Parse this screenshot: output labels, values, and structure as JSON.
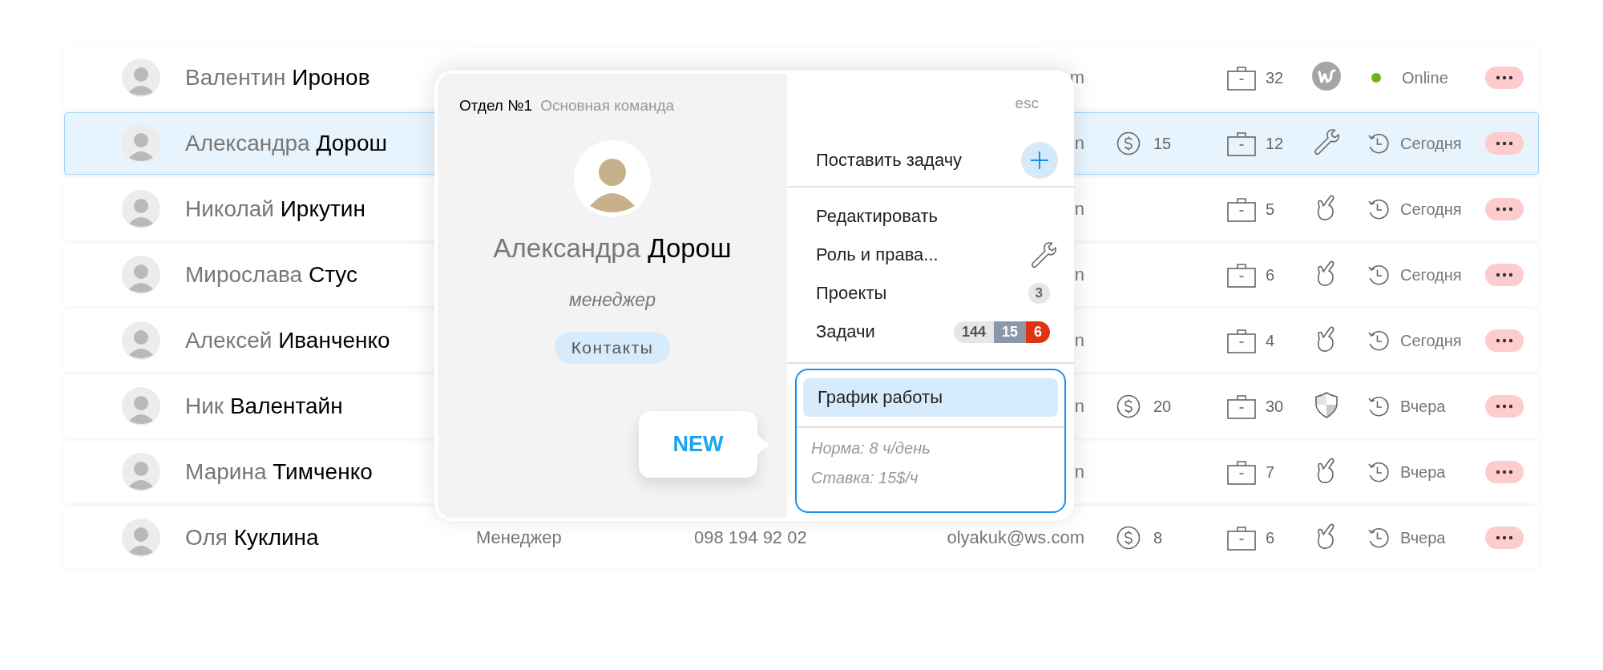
{
  "rows": [
    {
      "first": "Валентин",
      "last": "Иронов",
      "email": "m",
      "projects": "32",
      "access": {
        "kind": "logo"
      },
      "status": {
        "kind": "online",
        "text": "Online"
      },
      "selected": false
    },
    {
      "first": "Александра",
      "last": "Дорош",
      "email": "n",
      "payment": "15",
      "projects": "12",
      "access": {
        "kind": "wrench"
      },
      "status": {
        "kind": "recent",
        "text": "Сегодня"
      },
      "selected": true
    },
    {
      "first": "Николай",
      "last": "Иркутин",
      "email": "n",
      "projects": "5",
      "access": {
        "kind": "hand"
      },
      "status": {
        "kind": "recent",
        "text": "Сегодня"
      },
      "selected": false
    },
    {
      "first": "Мирослава",
      "last": "Стус",
      "email": "n",
      "projects": "6",
      "access": {
        "kind": "hand"
      },
      "status": {
        "kind": "recent",
        "text": "Сегодня"
      },
      "selected": false
    },
    {
      "first": "Алексей",
      "last": "Иванченко",
      "email": "n",
      "projects": "4",
      "access": {
        "kind": "hand"
      },
      "status": {
        "kind": "recent",
        "text": "Сегодня"
      },
      "selected": false
    },
    {
      "first": "Ник",
      "last": "Валентайн",
      "email": "n",
      "payment": "20",
      "projects": "30",
      "access": {
        "kind": "shield"
      },
      "status": {
        "kind": "recent",
        "text": "Вчера"
      },
      "selected": false
    },
    {
      "first": "Марина",
      "last": "Тимченко",
      "email": "n",
      "projects": "7",
      "access": {
        "kind": "hand"
      },
      "status": {
        "kind": "recent",
        "text": "Вчера"
      },
      "selected": false
    },
    {
      "first": "Оля",
      "last": "Куклина",
      "role": "Менеджер",
      "phone": "098 194 92 02",
      "email": "olyakuk@ws.com",
      "payment": "8",
      "projects": "6",
      "access": {
        "kind": "hand"
      },
      "status": {
        "kind": "recent",
        "text": "Вчера"
      },
      "selected": false
    }
  ],
  "card": {
    "department": "Отдел №1",
    "team": "Основная команда",
    "first": "Александра",
    "last": "Дорош",
    "role": "менеджер",
    "contacts": "Контакты",
    "callout": "NEW",
    "close": "esc",
    "menu_groups": [
      [
        {
          "kind": "action",
          "label": "Поставить задачу"
        }
      ],
      [
        {
          "kind": "plain",
          "label": "Редактировать"
        },
        {
          "kind": "icon",
          "label": "Роль и права..."
        },
        {
          "kind": "count",
          "label": "Проекты",
          "count": "3"
        },
        {
          "kind": "tasks",
          "label": "Задачи",
          "badges": [
            {
              "text": "144",
              "color": "#e6e6e6"
            },
            {
              "text": "15",
              "color": "#8898aa"
            },
            {
              "text": "6",
              "color": "#dd3412"
            }
          ]
        }
      ]
    ],
    "schedule": {
      "label": "График работы",
      "selected": true,
      "details": [
        "Норма: 8 ч/день",
        "Ставка: 15$/ч"
      ]
    }
  }
}
